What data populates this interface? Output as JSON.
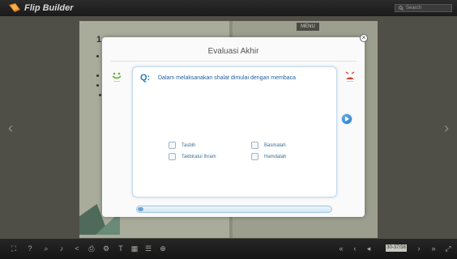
{
  "app": {
    "title": "Flip Builder"
  },
  "search": {
    "placeholder": "Search"
  },
  "book": {
    "menu_label": "MENU",
    "page_heading": "1"
  },
  "dialog": {
    "title": "Evaluasi Akhir",
    "question_label": "Q:",
    "question_text": "Dalam melaksanakan shalat dimulai dengan membaca",
    "options": [
      "Tasbih",
      "Basmalah",
      "Takbiratul Ihram",
      "Hamdalah"
    ],
    "progress": 0.03
  },
  "toolbar": {
    "page_counter": "30-37/38"
  },
  "icons": {
    "toolbar_left": [
      "fullscreen-icon",
      "help-icon",
      "zoom-icon",
      "sound-icon",
      "share-icon",
      "print-icon",
      "settings-icon",
      "text-icon",
      "thumbnails-icon",
      "list-icon",
      "zoom-in-icon"
    ],
    "toolbar_right": [
      "first-page-icon",
      "prev-page-icon",
      "page-back-icon",
      "next-page-icon",
      "last-page-icon",
      "more-icon"
    ]
  },
  "colors": {
    "accent": "#1f7cc0",
    "topbar": "#1e1e1e",
    "stage": "#4f4f47"
  }
}
